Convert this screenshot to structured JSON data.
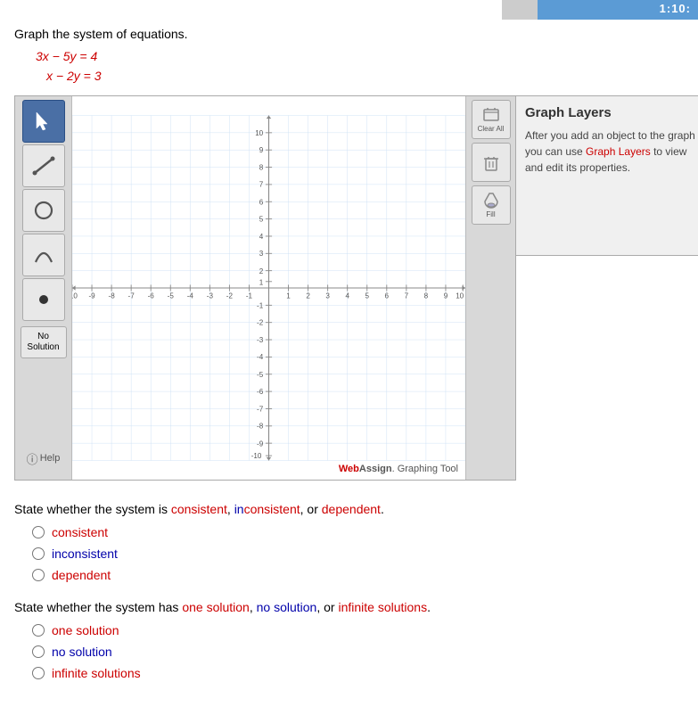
{
  "timer": {
    "text": "1:10:"
  },
  "instruction": "Graph the system of equations.",
  "equations": [
    "3x − 5y = 4",
    "x − 2y = 3"
  ],
  "graph": {
    "xMin": -10,
    "xMax": 10,
    "yMin": -10,
    "yMax": 10,
    "watermark": "WebAssign. Graphing Tool"
  },
  "toolbar": {
    "tools": [
      {
        "name": "select",
        "icon": "arrow",
        "active": true
      },
      {
        "name": "line",
        "icon": "line",
        "active": false
      },
      {
        "name": "circle",
        "icon": "circle",
        "active": false
      },
      {
        "name": "parabola",
        "icon": "parabola",
        "active": false
      },
      {
        "name": "point",
        "icon": "point",
        "active": false
      }
    ],
    "no_solution_label": "No\nSolution",
    "help_label": "Help"
  },
  "right_panel": {
    "clear_all_label": "Clear All",
    "delete_label": "Delete",
    "fill_label": "Fill"
  },
  "graph_layers": {
    "title": "Graph Layers",
    "description": "After you add an object to the graph you can use Graph Layers to view and edit its properties.",
    "description_highlight": "Graph Layers"
  },
  "state_question1": {
    "text": "State whether the system is consistent, inconsistent, or dependent.",
    "options": [
      {
        "value": "consistent",
        "label": "consistent",
        "color": "red"
      },
      {
        "value": "inconsistent",
        "label": "inconsistent",
        "color": "blue"
      },
      {
        "value": "dependent",
        "label": "dependent",
        "color": "red"
      }
    ]
  },
  "state_question2": {
    "text": "State whether the system has one solution, no solution, or infinite solutions.",
    "options": [
      {
        "value": "one_solution",
        "label": "one solution",
        "color": "red"
      },
      {
        "value": "no_solution",
        "label": "no solution",
        "color": "blue"
      },
      {
        "value": "infinite_solutions",
        "label": "infinite solutions",
        "color": "red"
      }
    ]
  }
}
